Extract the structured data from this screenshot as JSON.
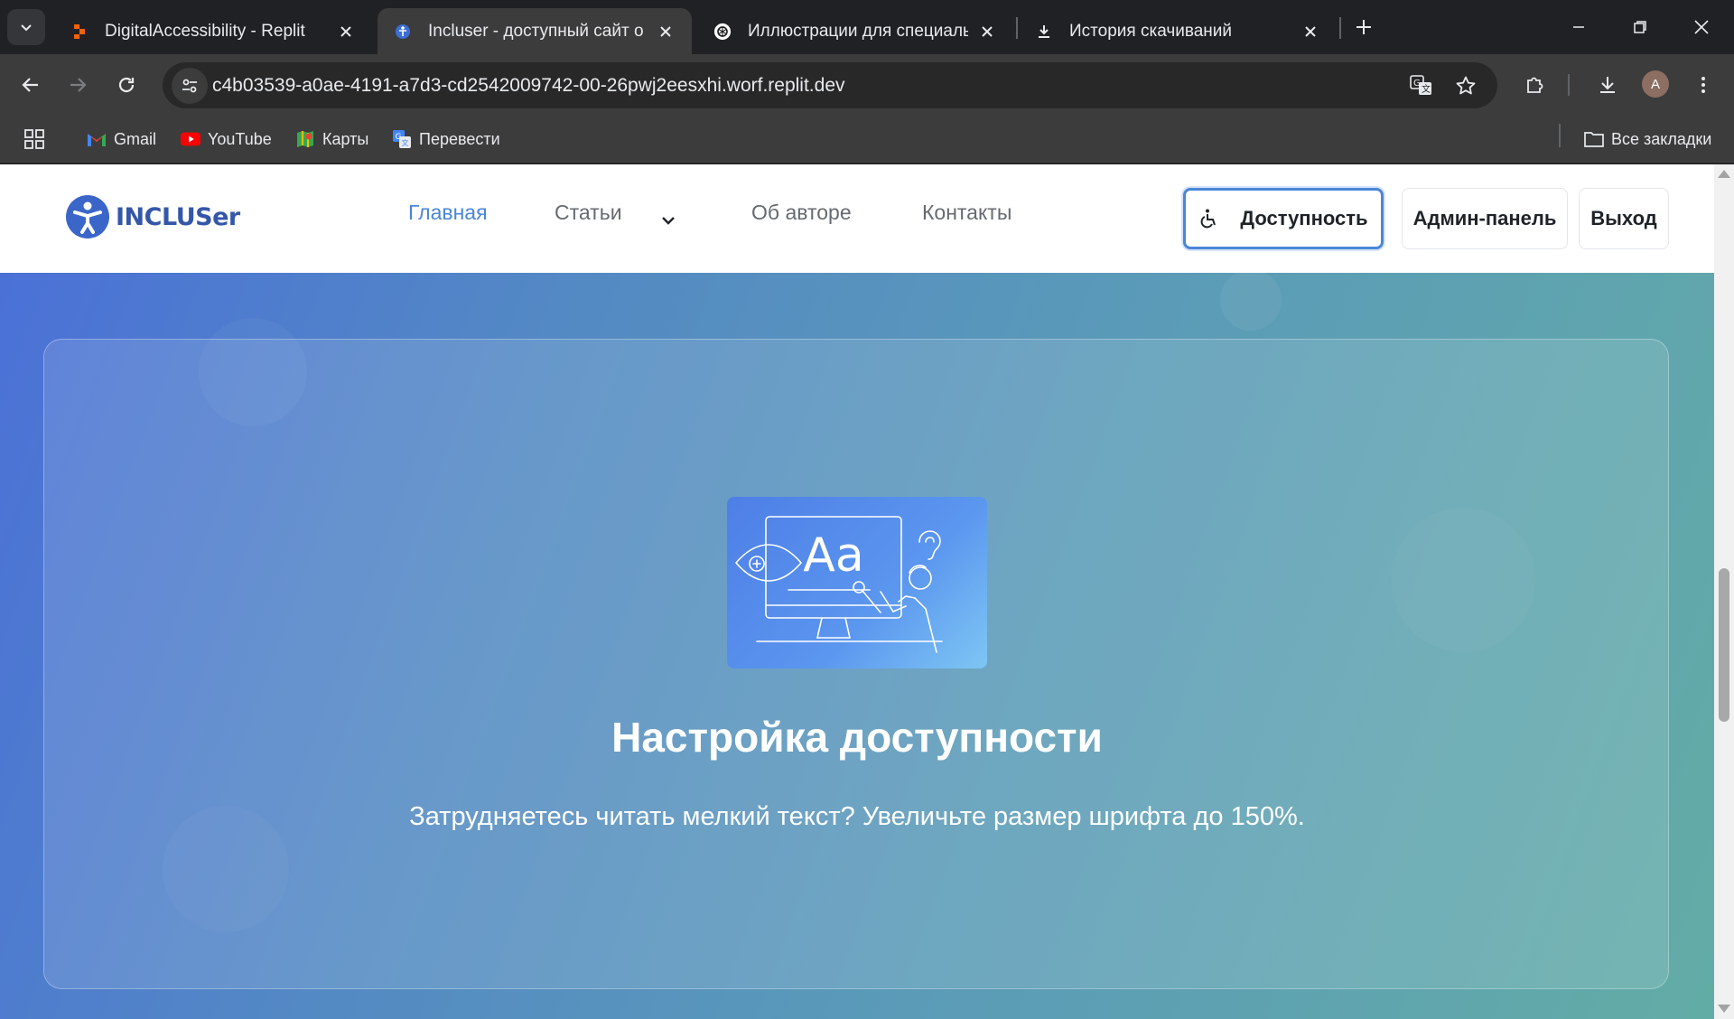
{
  "browser": {
    "tabs": [
      {
        "title": "DigitalAccessibility - Replit",
        "active": false
      },
      {
        "title": "Incluser - доступный сайт о до",
        "active": true
      },
      {
        "title": "Иллюстрации для специальны",
        "active": false
      },
      {
        "title": "История скачиваний",
        "active": false
      }
    ],
    "url": "c4b03539-a0ae-4191-a7d3-cd2542009742-00-26pwj2eesxhi.worf.replit.dev",
    "avatar_letter": "A",
    "bookmarks": [
      {
        "label": "Gmail",
        "icon": "gmail-icon"
      },
      {
        "label": "YouTube",
        "icon": "youtube-icon"
      },
      {
        "label": "Карты",
        "icon": "maps-icon"
      },
      {
        "label": "Перевести",
        "icon": "translate-icon"
      }
    ],
    "all_bookmarks_label": "Все закладки"
  },
  "site": {
    "logo_text": "INCLUSer",
    "nav": [
      {
        "label": "Главная",
        "active": true
      },
      {
        "label": "Статьи",
        "active": false
      },
      {
        "label": "Об авторе",
        "active": false
      },
      {
        "label": "Контакты",
        "active": false
      }
    ],
    "buttons": {
      "accessibility": "Доступность",
      "admin": "Админ-панель",
      "logout": "Выход"
    },
    "hero": {
      "illustration_text": "Aa",
      "title": "Настройка доступности",
      "text": "Затрудняетесь читать мелкий текст? Увеличьте размер шрифта до 150%."
    }
  },
  "colors": {
    "accent": "#4a86d8",
    "logo": "#3557a8",
    "browser_bg": "#202124"
  }
}
